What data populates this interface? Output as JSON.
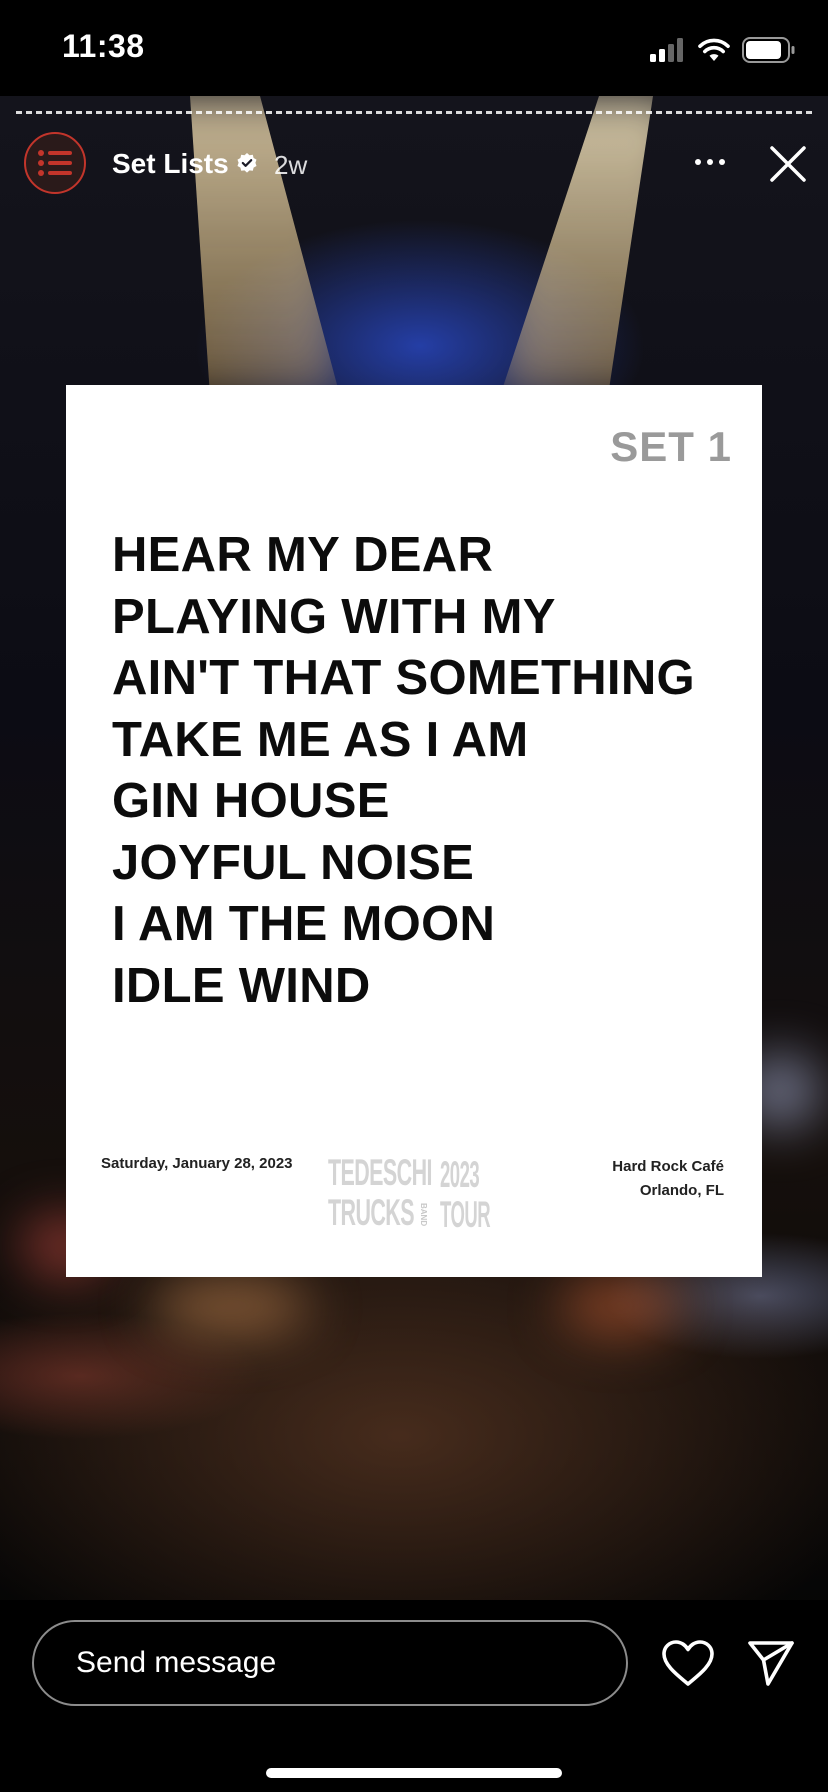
{
  "status_bar": {
    "time": "11:38",
    "icons": [
      "cellular-signal-icon",
      "wifi-icon",
      "battery-icon"
    ]
  },
  "story": {
    "account_name": "Set Lists",
    "verified": true,
    "post_age": "2w",
    "avatar_icon": "list-icon",
    "accent_color": "#c2352b"
  },
  "setlist": {
    "set_label": "SET 1",
    "songs": [
      "HEAR MY DEAR",
      "PLAYING WITH MY",
      "AIN'T THAT SOMETHING",
      "TAKE ME AS I AM",
      "GIN HOUSE",
      "JOYFUL NOISE",
      "I AM THE MOON",
      "IDLE WIND"
    ],
    "date": "Saturday, January 28, 2023",
    "venue_name": "Hard Rock Café",
    "venue_city": "Orlando, FL",
    "logo": {
      "line1": "TEDESCHI",
      "line2": "TRUCKS",
      "band_word": "BAND",
      "year": "2023",
      "tour_word": "TOUR"
    }
  },
  "reply": {
    "placeholder": "Send message"
  }
}
